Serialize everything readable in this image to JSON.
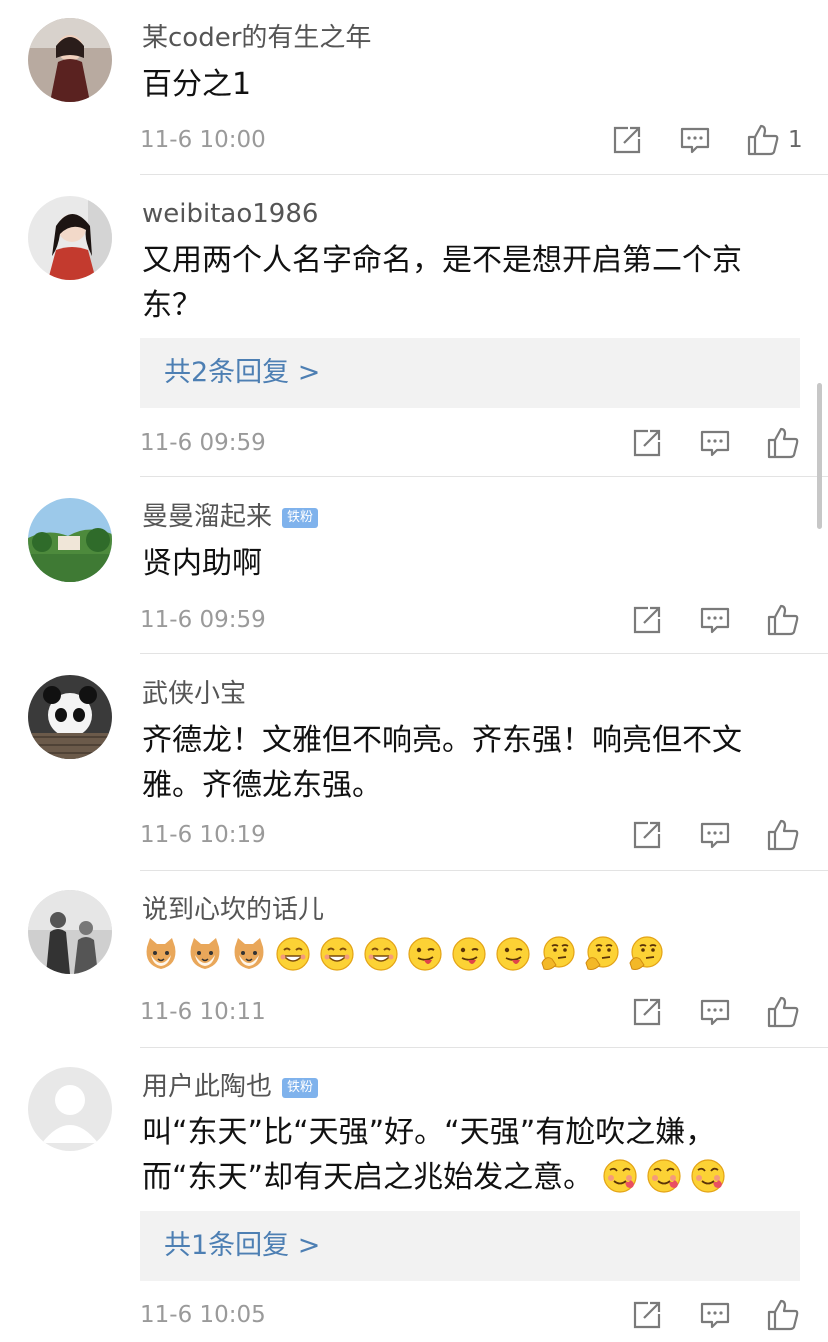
{
  "comments": [
    {
      "username": "某coder的有生之年",
      "badge": "",
      "text": "百分之1",
      "time": "11-6 10:00",
      "like_count": "1",
      "reply_label": ""
    },
    {
      "username": "weibitao1986",
      "badge": "",
      "text": "又用两个人名字命名，是不是想开启第二个京东？",
      "time": "11-6 09:59",
      "like_count": "",
      "reply_label": "共2条回复 >"
    },
    {
      "username": "曼曼溜起来",
      "badge": "铁粉",
      "text": "贤内助啊",
      "time": "11-6 09:59",
      "like_count": "",
      "reply_label": ""
    },
    {
      "username": "武侠小宝",
      "badge": "",
      "text": "齐德龙！文雅但不响亮。齐东强！响亮但不文雅。齐德龙东强。",
      "time": "11-6 10:19",
      "like_count": "",
      "reply_label": ""
    },
    {
      "username": "说到心坎的话儿",
      "badge": "",
      "text": "",
      "time": "11-6 10:11",
      "like_count": "",
      "reply_label": "",
      "emojis": [
        "cat-emoji",
        "cat-emoji",
        "cat-emoji",
        "grin-emoji",
        "grin-emoji",
        "grin-emoji",
        "tongue-emoji",
        "tongue-emoji",
        "tongue-emoji",
        "think-emoji",
        "think-emoji",
        "think-emoji"
      ]
    },
    {
      "username": "用户此陶也",
      "badge": "铁粉",
      "text": "叫“东天”比“天强”好。“天强”有尬吹之嫌，而“东天”却有天启之兆始发之意。",
      "time": "11-6 10:05",
      "like_count": "",
      "reply_label": "共1条回复 >",
      "emojis": [
        "love-emoji",
        "love-emoji",
        "love-emoji"
      ]
    }
  ],
  "icons": {
    "share": "share-icon",
    "comment": "comment-icon",
    "like": "thumbs-up-icon"
  },
  "colors": {
    "link": "#4d7fb3",
    "badge": "#7fb2ec",
    "meta": "#9a9a9a"
  }
}
